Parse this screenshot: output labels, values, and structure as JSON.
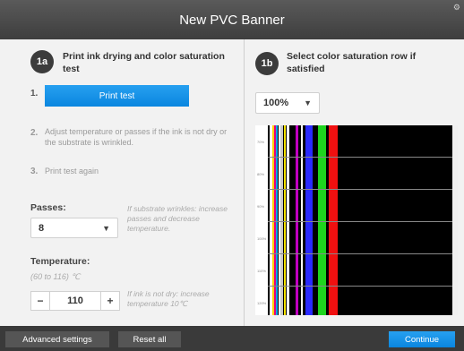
{
  "window": {
    "title": "New PVC Banner",
    "corner_icon": "gear-icon"
  },
  "left": {
    "badge": "1a",
    "title": "Print ink drying and color saturation test",
    "step1": {
      "num": "1.",
      "button": "Print test"
    },
    "step2": {
      "num": "2.",
      "text": "Adjust temperature or passes if the ink is not dry or the substrate is wrinkled."
    },
    "step3": {
      "num": "3.",
      "text": "Print test again"
    },
    "passes": {
      "label": "Passes:",
      "value": "8",
      "hint": "If substrate wrinkles: increase passes and decrease temperature."
    },
    "temperature": {
      "label": "Temperature:",
      "range": "(60 to 116) ℃",
      "value": "110",
      "minus": "−",
      "plus": "+",
      "hint": "If ink is not dry: increase temperature 10℃"
    }
  },
  "right": {
    "badge": "1b",
    "title": "Select color saturation row if satisfied",
    "saturation_select": "100%",
    "row_labels": [
      "70%",
      "80%",
      "90%",
      "100%",
      "110%",
      "120%"
    ],
    "colors": {
      "accent": "#0a86df",
      "footer": "#3a3a3a"
    }
  },
  "footer": {
    "advanced": "Advanced settings",
    "reset": "Reset all",
    "continue": "Continue"
  }
}
